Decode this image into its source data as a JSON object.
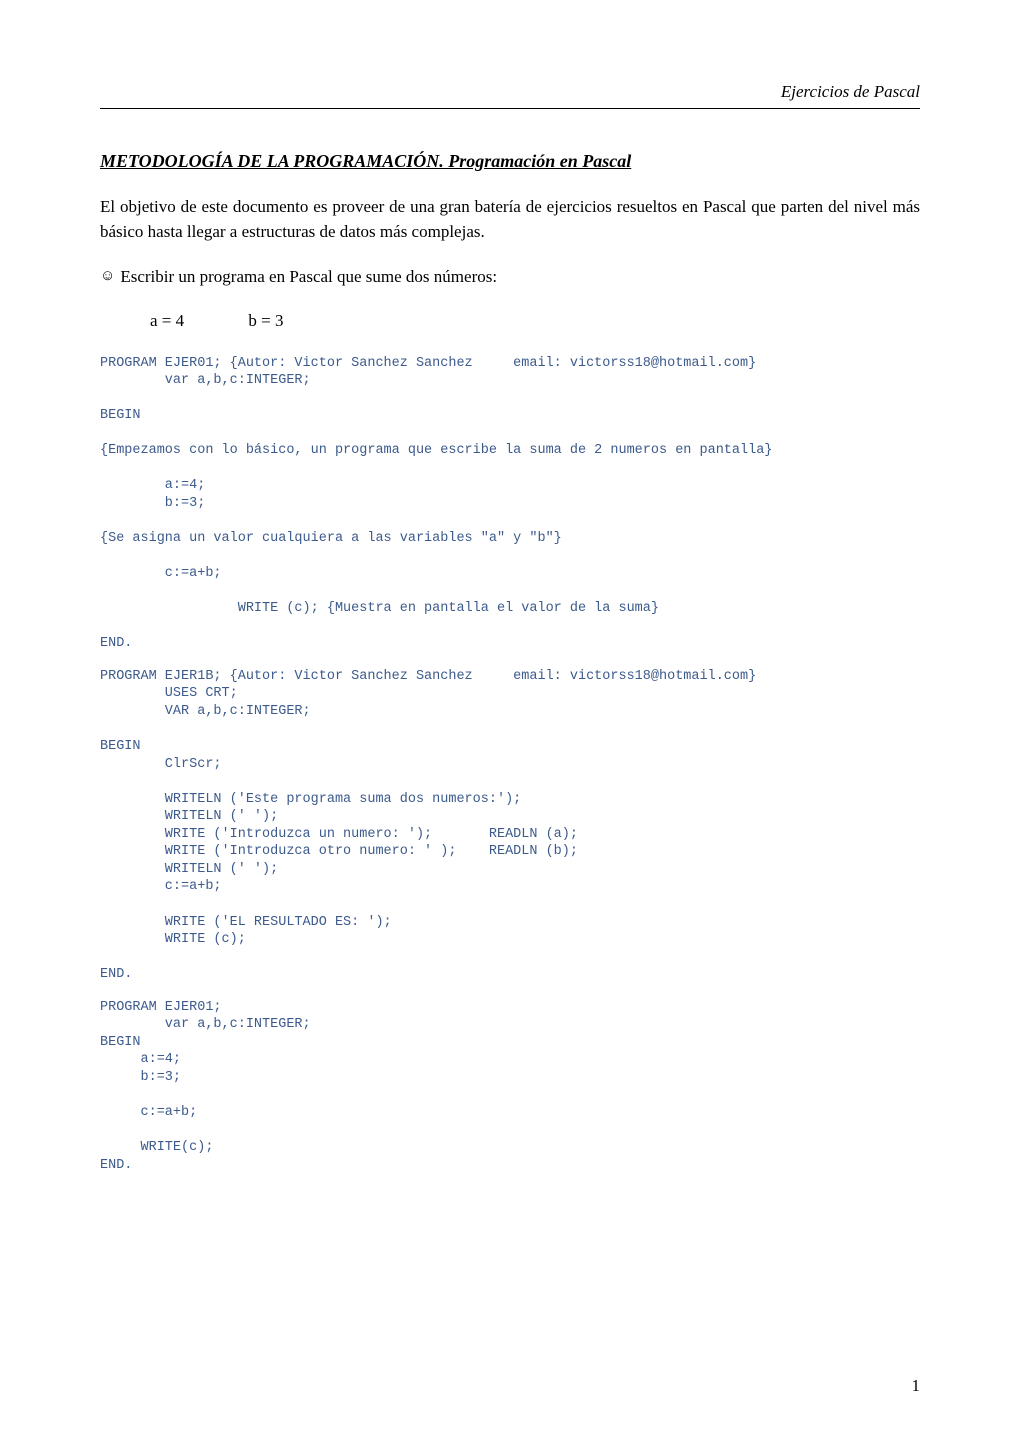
{
  "header": {
    "text": "Ejercicios de Pascal"
  },
  "title": "METODOLOGÍA DE LA PROGRAMACIÓN. Programación en Pascal",
  "intro": "El objetivo de este documento es proveer de una gran batería de ejercicios resueltos en Pascal que parten del nivel más básico hasta llegar a estructuras de datos más complejas.",
  "exercise_prompt": "Escribir un programa en Pascal que sume dos números:",
  "values": {
    "a": "a = 4",
    "b": "b = 3"
  },
  "code1": "PROGRAM EJER01; {Autor: Victor Sanchez Sanchez     email: victorss18@hotmail.com}\n        var a,b,c:INTEGER;\n\nBEGIN\n\n{Empezamos con lo básico, un programa que escribe la suma de 2 numeros en pantalla}\n\n        a:=4;\n        b:=3;\n\n{Se asigna un valor cualquiera a las variables \"a\" y \"b\"}\n\n        c:=a+b;\n\n                 WRITE (c); {Muestra en pantalla el valor de la suma}\n\nEND.",
  "code2": "PROGRAM EJER1B; {Autor: Victor Sanchez Sanchez     email: victorss18@hotmail.com}\n        USES CRT;\n        VAR a,b,c:INTEGER;\n\nBEGIN\n        ClrScr;\n\n        WRITELN ('Este programa suma dos numeros:');\n        WRITELN (' ');\n        WRITE ('Introduzca un numero: ');       READLN (a);\n        WRITE ('Introduzca otro numero: ' );    READLN (b);\n        WRITELN (' ');\n        c:=a+b;\n\n        WRITE ('EL RESULTADO ES: ');\n        WRITE (c);\n\nEND.",
  "code3": "PROGRAM EJER01;\n        var a,b,c:INTEGER;\nBEGIN\n     a:=4;\n     b:=3;\n\n     c:=a+b;\n\n     WRITE(c);\nEND.",
  "page_number": "1"
}
